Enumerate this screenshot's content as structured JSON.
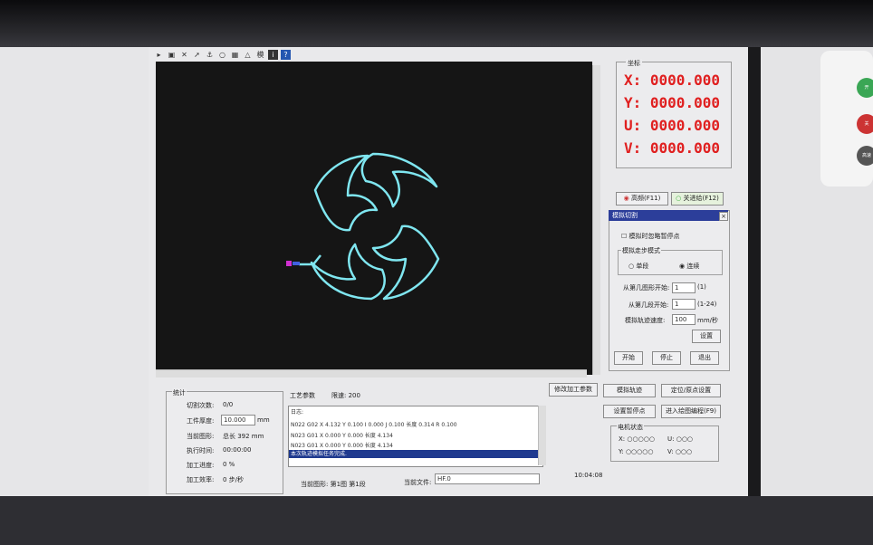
{
  "toolbar": {
    "icons": [
      "open-icon",
      "save-icon",
      "cut-tool-icon",
      "cursor-icon",
      "anchor-icon",
      "circle-icon",
      "grid-icon",
      "terrain-icon",
      "mode-icon",
      "info-icon",
      "help-icon"
    ],
    "mode_label": "模"
  },
  "coords": {
    "title": "坐标",
    "rows": [
      {
        "axis": "X:",
        "value": "0000.000"
      },
      {
        "axis": "Y:",
        "value": "0000.000"
      },
      {
        "axis": "U:",
        "value": "0000.000"
      },
      {
        "axis": "V:",
        "value": "0000.000"
      }
    ]
  },
  "freq": {
    "high_label": "高频(F11)",
    "feed_label": "关进给(F12)"
  },
  "sim": {
    "title": "模拟切割",
    "pause_check": "模拟时忽略暂停点",
    "mode_group": "模拟走步模式",
    "single_label": "单段",
    "continuous_label": "连续",
    "start_figure_label": "从第几图形开始:",
    "start_figure_value": "1",
    "start_figure_range": "(1)",
    "start_segment_label": "从第几段开始:",
    "start_segment_value": "1",
    "start_segment_range": "(1-24)",
    "speed_label": "模拟轨迹速度:",
    "speed_value": "100",
    "speed_unit": "mm/秒",
    "set_button": "设置",
    "start_button": "开始",
    "stop_button": "停止",
    "exit_button": "退出"
  },
  "actions": {
    "sim_track": "模拟轨迹",
    "locate_origin": "定位/原点设置",
    "set_pause": "设置暂停点",
    "enter_programming": "进入绘图编程(F9)"
  },
  "motor": {
    "title": "电机状态",
    "x_label": "X:",
    "x_dots": "○○○○○",
    "u_label": "U:",
    "u_dots": "○○○",
    "y_label": "Y:",
    "y_dots": "○○○○○",
    "v_label": "V:",
    "v_dots": "○○○"
  },
  "stats": {
    "title": "统计",
    "rows": [
      {
        "label": "切割次数:",
        "value": "0/0"
      },
      {
        "label": "工件厚度:",
        "value": "10.000",
        "unit": "mm"
      },
      {
        "label": "当前图形:",
        "value": "总长 392 mm"
      },
      {
        "label": "执行时间:",
        "value": "00:00:00"
      },
      {
        "label": "加工进度:",
        "value": "0 %"
      },
      {
        "label": "加工效率:",
        "value": "0 步/秒"
      }
    ]
  },
  "process": {
    "params_label": "工艺参数",
    "speed_limit": "限速: 200",
    "modify_button": "修改加工参数"
  },
  "log": {
    "title": "日志:",
    "lines": [
      "N022 G02 X  4.132 Y  0.100 I  0.000 J  0.100  长度 0.314 R 0.100",
      "N023 G01 X  0.000 Y  0.000  长度 4.134",
      "N023 G01 X  0.000 Y  0.000  长度 4.134"
    ],
    "highlight": "本次轨迹模拟任务完成."
  },
  "status": {
    "current_figure": "当前图形: 第1图 第1段",
    "current_file_label": "当前文件:",
    "current_file": "HF.0",
    "time": "10:04:08"
  },
  "device": {
    "btn1": "开",
    "btn2": "关",
    "btn3": "高速"
  },
  "colors": {
    "coord_red": "#e02020",
    "path_cyan": "#7fe6f0",
    "title_blue": "#2c3e9a"
  }
}
